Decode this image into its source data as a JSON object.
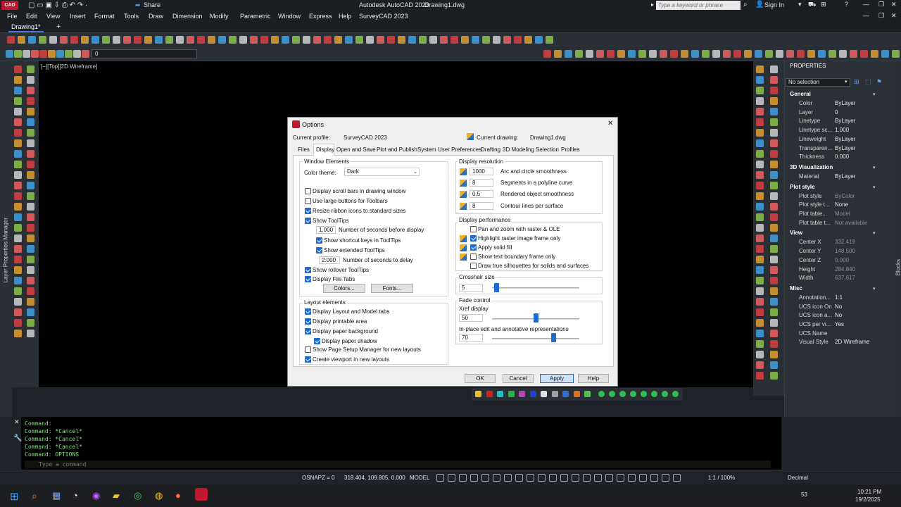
{
  "app": {
    "title": "Autodesk AutoCAD 2023",
    "file": "Drawing1.dwg",
    "search_placeholder": "Type a keyword or phrase",
    "share": "Share",
    "signin": "Sign In",
    "logo": "CAD"
  },
  "menu": [
    "File",
    "Edit",
    "View",
    "Insert",
    "Format",
    "Tools",
    "Draw",
    "Dimension",
    "Modify",
    "Parametric",
    "Window",
    "Express",
    "Help",
    "SurveyCAD 2023"
  ],
  "tabs": {
    "doc": "Drawing1*",
    "add": "+"
  },
  "layer_current": "0",
  "viewport_label": "[−][Top][2D Wireframe]",
  "left_strip_label": "Layer Properties Manager",
  "blocks_label": "Blocks",
  "properties": {
    "title": "PROPERTIES",
    "selection": "No selection",
    "sections": {
      "general": "General",
      "viz": "3D Visualization",
      "plot": "Plot style",
      "view": "View",
      "misc": "Misc"
    },
    "general": [
      {
        "label": "Color",
        "value": "ByLayer"
      },
      {
        "label": "Layer",
        "value": "0"
      },
      {
        "label": "Linetype",
        "value": "ByLayer"
      },
      {
        "label": "Linetype sc...",
        "value": "1.000"
      },
      {
        "label": "Lineweight",
        "value": "ByLayer"
      },
      {
        "label": "Transparen...",
        "value": "ByLayer"
      },
      {
        "label": "Thickness",
        "value": "0.000"
      }
    ],
    "viz": [
      {
        "label": "Material",
        "value": "ByLayer"
      }
    ],
    "plot": [
      {
        "label": "Plot style",
        "value": "ByColor"
      },
      {
        "label": "Plot style t...",
        "value": "None"
      },
      {
        "label": "Plot table...",
        "value": "Model"
      },
      {
        "label": "Plot table t...",
        "value": "Not available"
      }
    ],
    "view": [
      {
        "label": "Center X",
        "value": "332.419"
      },
      {
        "label": "Center Y",
        "value": "148.500"
      },
      {
        "label": "Center Z",
        "value": "0.000"
      },
      {
        "label": "Height",
        "value": "284.840"
      },
      {
        "label": "Width",
        "value": "637.617"
      }
    ],
    "misc": [
      {
        "label": "Annotation...",
        "value": "1:1"
      },
      {
        "label": "UCS icon On",
        "value": "No"
      },
      {
        "label": "UCS icon a...",
        "value": "No"
      },
      {
        "label": "UCS per vi...",
        "value": "Yes"
      },
      {
        "label": "UCS Name",
        "value": ""
      },
      {
        "label": "Visual Style",
        "value": "2D Wireframe"
      }
    ]
  },
  "command": {
    "lines": [
      "Command:",
      "Command: *Cancel*",
      "Command: *Cancel*",
      "Command: *Cancel*",
      "Command: OPTIONS"
    ],
    "placeholder": "Type a command"
  },
  "status": {
    "osnapz": "OSNAPZ = 0",
    "coords": "318.404, 109.805, 0.000",
    "model": "MODEL",
    "scale": "1:1 / 100%",
    "units": "Decimal"
  },
  "clock": {
    "time": "10:21 PM",
    "date": "19/2/2025"
  },
  "taskbar_badge": "53",
  "dialog": {
    "title": "Options",
    "profile_label": "Current profile:",
    "profile": "SurveyCAD 2023",
    "drawing_label": "Current drawing:",
    "drawing": "Drawing1.dwg",
    "tabs": [
      "Files",
      "Display",
      "Open and Save",
      "Plot and Publish",
      "System",
      "User Preferences",
      "Drafting",
      "3D Modeling",
      "Selection",
      "Profiles"
    ],
    "active_tab": "Display",
    "window_elements": {
      "title": "Window Elements",
      "color_theme_label": "Color theme:",
      "color_theme": "Dark",
      "scroll_bars": "Display scroll bars in drawing window",
      "large_buttons": "Use large buttons for Toolbars",
      "resize_ribbon": "Resize ribbon icons to standard sizes",
      "show_tooltips": "Show ToolTips",
      "seconds_before": "1.000",
      "seconds_before_label": "Number of seconds before display",
      "shortcut_keys": "Show shortcut keys in ToolTips",
      "extended": "Show extended ToolTips",
      "delay": "2.000",
      "delay_label": "Number of seconds to delay",
      "rollover": "Show rollover ToolTips",
      "file_tabs": "Display File Tabs",
      "colors_btn": "Colors...",
      "fonts_btn": "Fonts..."
    },
    "layout_elements": {
      "title": "Layout elements",
      "layout_tabs": "Display Layout and Model tabs",
      "printable": "Display printable area",
      "paper_bg": "Display paper background",
      "paper_shadow": "Display paper shadow",
      "page_setup": "Show Page Setup Manager for new layouts",
      "viewport": "Create viewport in new layouts"
    },
    "resolution": {
      "title": "Display resolution",
      "items": [
        {
          "value": "1000",
          "label": "Arc and circle smoothness"
        },
        {
          "value": "8",
          "label": "Segments in a polyline curve"
        },
        {
          "value": "0.5",
          "label": "Rendered object smoothness"
        },
        {
          "value": "8",
          "label": "Contour lines per surface"
        }
      ]
    },
    "performance": {
      "title": "Display performance",
      "pan_zoom": "Pan and zoom with raster & OLE",
      "highlight": "Highlight raster image frame only",
      "solid_fill": "Apply solid fill",
      "text_boundary": "Show text boundary frame only",
      "silhouettes": "Draw true silhouettes for solids and surfaces"
    },
    "crosshair": {
      "title": "Crosshair size",
      "value": "5",
      "level": 0.05
    },
    "fade": {
      "title": "Fade control",
      "xref_label": "Xref display",
      "xref": "50",
      "xref_level": 0.5,
      "inplace_label": "In-place edit and annotative representations",
      "inplace": "70",
      "inplace_level": 0.7
    },
    "buttons": {
      "ok": "OK",
      "cancel": "Cancel",
      "apply": "Apply",
      "help": "Help"
    }
  },
  "swatch_colors": [
    "#e8c21d",
    "#d62020",
    "#20c0c0",
    "#30b040",
    "#c040c0",
    "#2040d0",
    "#e0e0e0",
    "#a0a0a0",
    "#3070d0",
    "#e07020",
    "#50c050"
  ],
  "accent": "#1e6cd1"
}
